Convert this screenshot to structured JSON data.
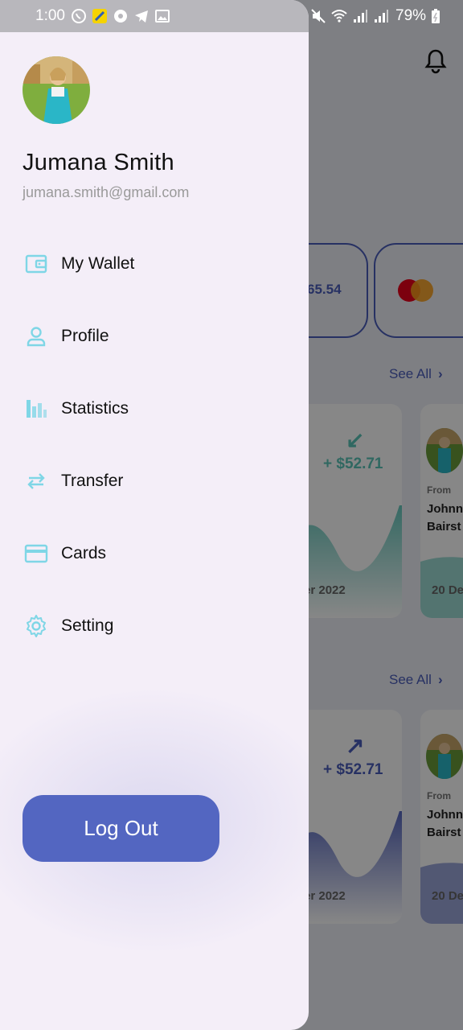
{
  "status_bar": {
    "time": "1:00",
    "battery": "79%"
  },
  "user": {
    "name": "Jumana Smith",
    "email": "jumana.smith@gmail.com"
  },
  "menu": [
    {
      "label": "My Wallet",
      "icon": "wallet-icon"
    },
    {
      "label": "Profile",
      "icon": "person-icon"
    },
    {
      "label": "Statistics",
      "icon": "bar-chart-icon"
    },
    {
      "label": "Transfer",
      "icon": "swap-arrows-icon"
    },
    {
      "label": "Cards",
      "icon": "credit-card-icon"
    },
    {
      "label": "Setting",
      "icon": "gear-icon"
    }
  ],
  "logout_label": "Log Out",
  "background": {
    "balance_partial": "65.54",
    "see_all": "See All",
    "transactions": [
      {
        "amount": "+ $52.71",
        "date_partial": "er 2022",
        "color": "#5cc4b8"
      },
      {
        "amount": "+ $52.71",
        "date_partial": "er 2022",
        "color": "#4b5dbb"
      }
    ],
    "from_label": "From",
    "from_name": "Johnny Bairstow",
    "from_name_partial_1": "Johnn",
    "from_name_partial_2": "Bairst",
    "mini_date_partial": "20 De"
  },
  "colors": {
    "accent": "#5366c1",
    "icon_teal": "#7fd6e6",
    "drawer_bg": "#f4eef8"
  }
}
